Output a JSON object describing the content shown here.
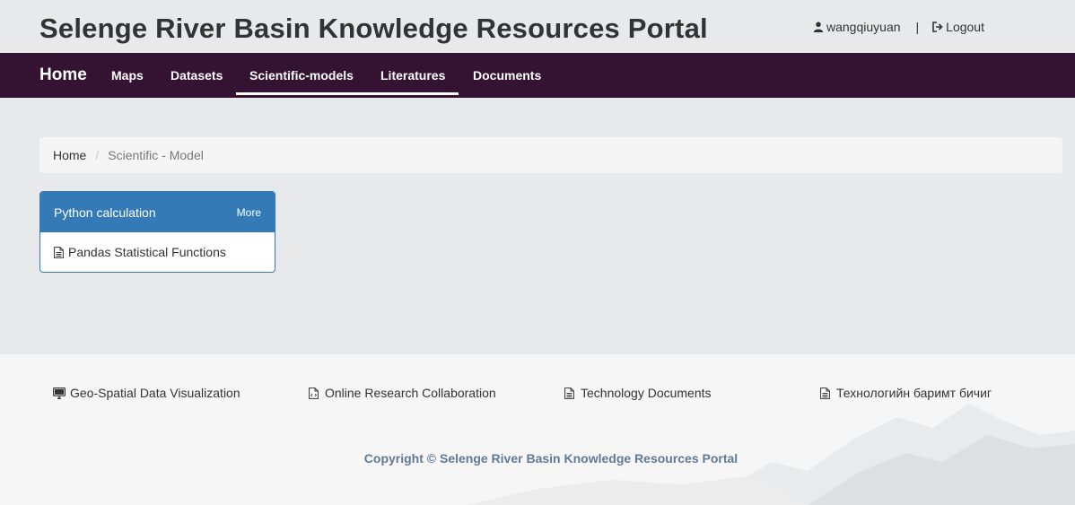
{
  "header": {
    "site_title": "Selenge River Basin Knowledge Resources Portal",
    "username": "wangqiuyuan",
    "separator": "|",
    "logout_label": "Logout"
  },
  "nav": {
    "home": "Home",
    "items": [
      "Maps",
      "Datasets",
      "Scientific-models",
      "Literatures",
      "Documents"
    ],
    "active": "Scientific-models"
  },
  "breadcrumb": {
    "home": "Home",
    "separator": "/",
    "current": "Scientific - Model"
  },
  "panel": {
    "title": "Python calculation",
    "more_label": "More",
    "items": [
      "Pandas Statistical Functions"
    ]
  },
  "footer": {
    "links": [
      {
        "icon": "monitor-icon",
        "label": "Geo-Spatial Data Visualization"
      },
      {
        "icon": "file-code-icon",
        "label": "Online Research Collaboration"
      },
      {
        "icon": "file-text-icon",
        "label": "Technology Documents"
      },
      {
        "icon": "file-text-icon",
        "label": "Технологийн баримт бичиг"
      }
    ],
    "copyright": "Copyright © Selenge River Basin Knowledge Resources Portal"
  },
  "colors": {
    "navbar_bg": "#341231",
    "panel_primary": "#337ab7",
    "page_bg": "#e8e9eb",
    "copyright_text": "#607a96"
  }
}
